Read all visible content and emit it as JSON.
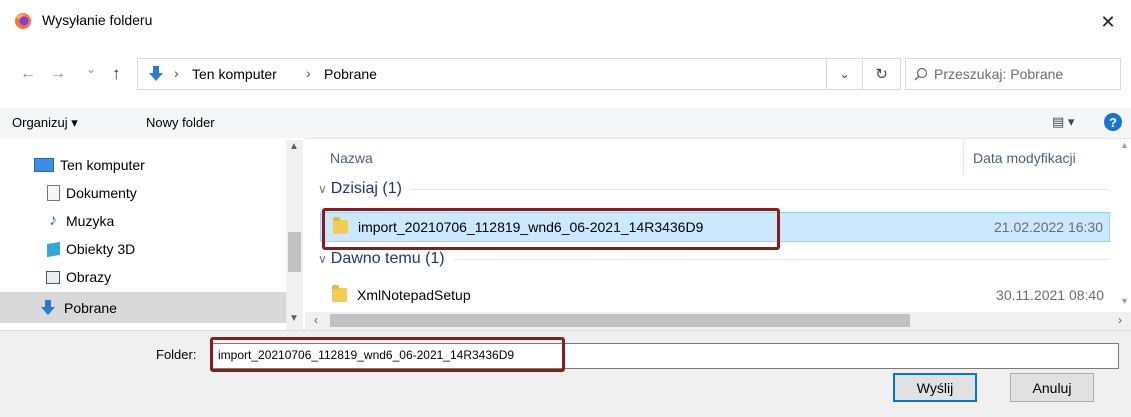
{
  "window": {
    "title": "Wysyłanie folderu",
    "close_glyph": "✕"
  },
  "nav": {
    "back_glyph": "←",
    "forward_glyph": "→",
    "recent_glyph": "⌄",
    "up_glyph": "↑",
    "path_icon": "download-arrow-icon",
    "breadcrumb": [
      "Ten komputer",
      "Pobrane"
    ],
    "separator": "›",
    "dropdown_glyph": "⌄",
    "refresh_glyph": "↻",
    "search_placeholder": "Przeszukaj: Pobrane"
  },
  "toolbar": {
    "organize_label": "Organizuj ▾",
    "new_folder_label": "Nowy folder",
    "view_glyph": "▤ ▾",
    "help_glyph": "?"
  },
  "sidebar": {
    "items": [
      {
        "label": "Ten komputer",
        "icon": "computer-icon"
      },
      {
        "label": "Dokumenty",
        "icon": "document-icon"
      },
      {
        "label": "Muzyka",
        "icon": "music-icon"
      },
      {
        "label": "Obiekty 3D",
        "icon": "cube-icon"
      },
      {
        "label": "Obrazy",
        "icon": "picture-icon"
      },
      {
        "label": "Pobrane",
        "icon": "download-icon",
        "selected": true
      }
    ]
  },
  "filelist": {
    "columns": {
      "name": "Nazwa",
      "date": "Data modyfikacji"
    },
    "groups": [
      {
        "label": "Dzisiaj (1)",
        "items": [
          {
            "name": "import_20210706_112819_wnd6_06-2021_14R3436D9",
            "date": "21.02.2022 16:30"
          }
        ]
      },
      {
        "label": "Dawno temu (1)",
        "items": [
          {
            "name": "XmlNotepadSetup",
            "date": "30.11.2021 08:40"
          }
        ]
      }
    ]
  },
  "footer": {
    "folder_label": "Folder:",
    "folder_value": "import_20210706_112819_wnd6_06-2021_14R3436D9",
    "send_label": "Wyślij",
    "cancel_label": "Anuluj"
  },
  "colors": {
    "highlight_border": "#8b1a1a",
    "selection_bg": "#cce8ff",
    "group_text": "#1e3287"
  }
}
